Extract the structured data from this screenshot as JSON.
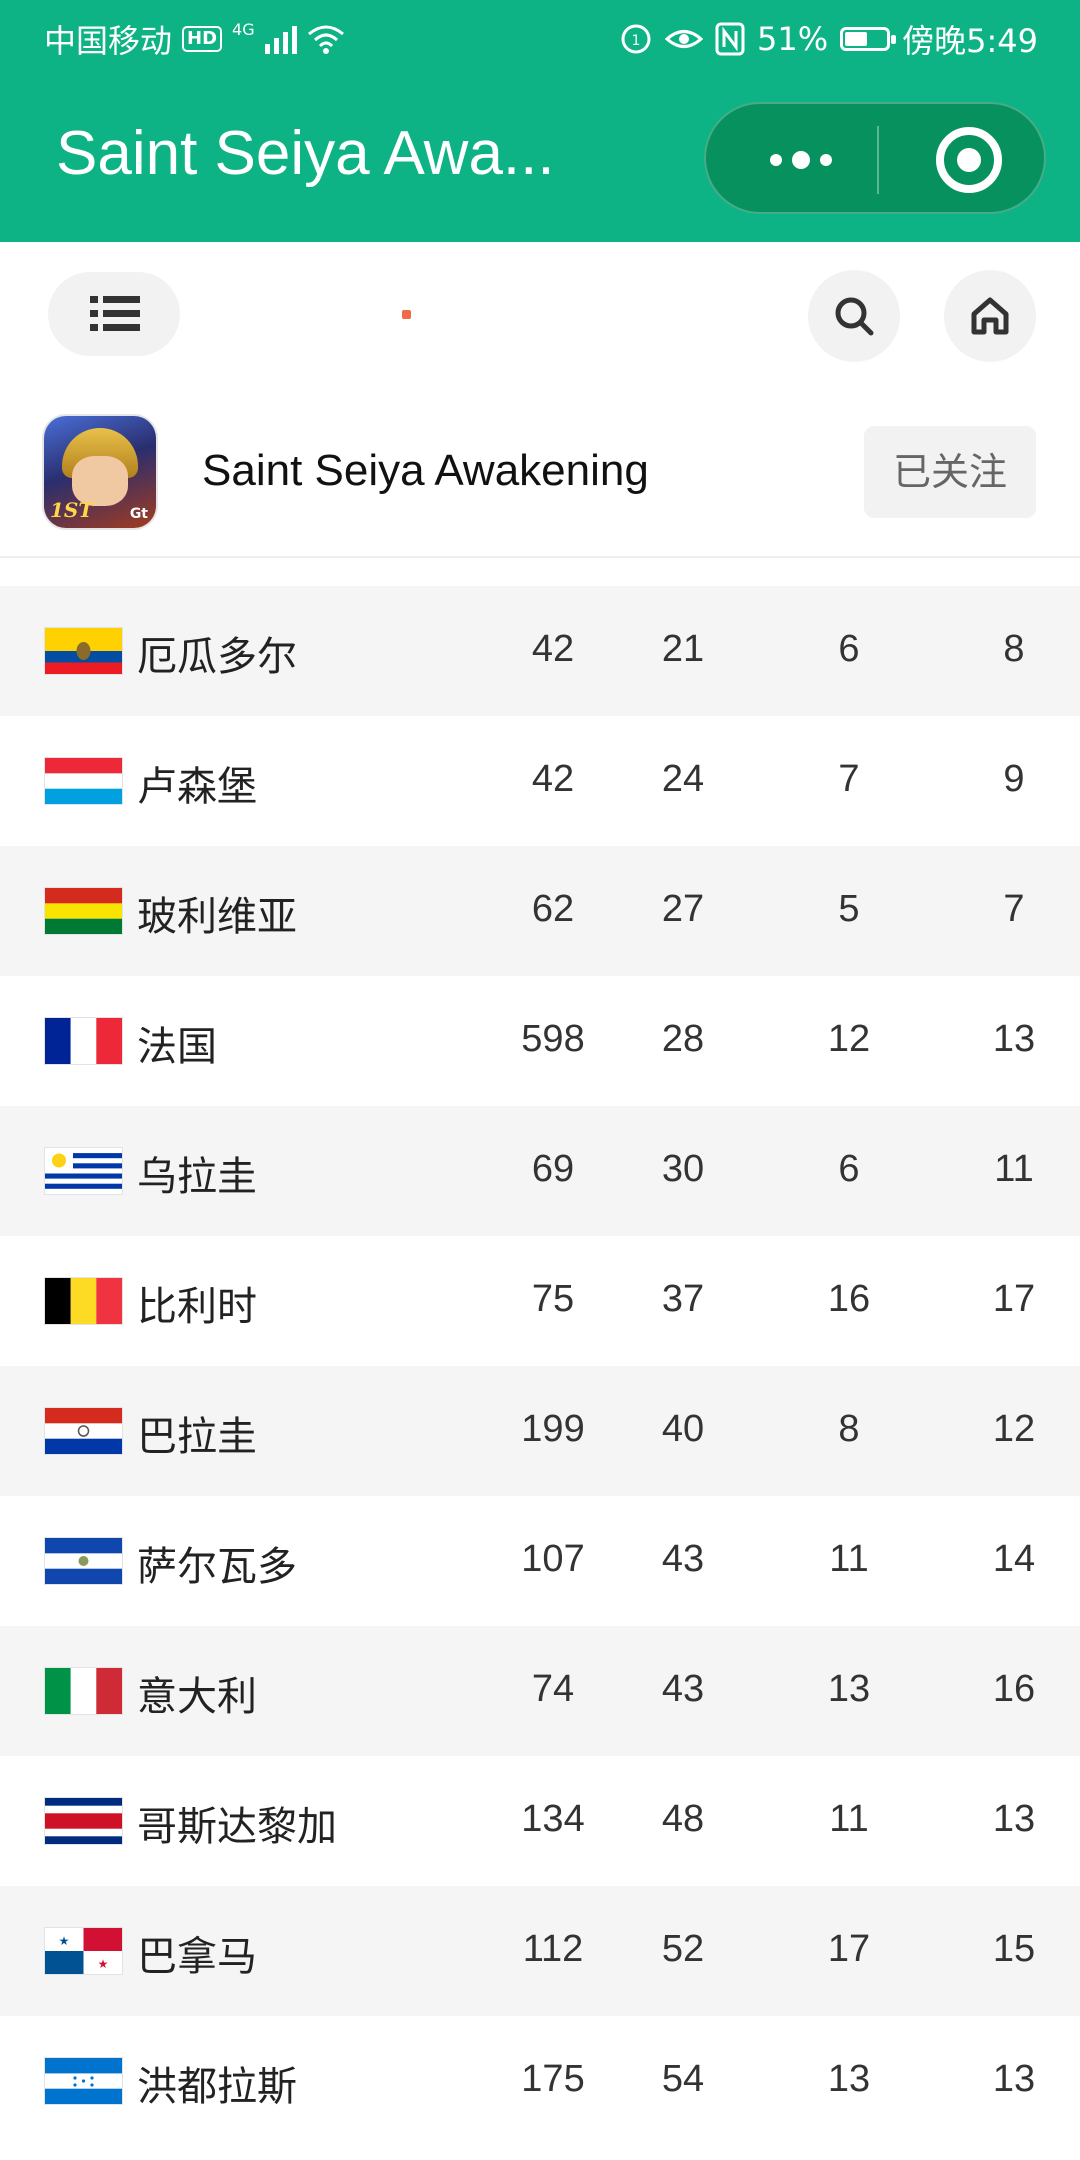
{
  "status_bar": {
    "carrier": "中国移动",
    "hd": "HD",
    "network": "4G",
    "battery_pct": "51%",
    "time": "傍晚5:49"
  },
  "header": {
    "title": "Saint Seiya Awa...",
    "more_icon": "more-dots-icon",
    "close_icon": "target-icon"
  },
  "toolbar": {
    "menu_icon": "list-icon",
    "search_icon": "search-icon",
    "home_icon": "home-icon"
  },
  "game": {
    "name": "Saint Seiya Awakening",
    "follow_label": "已关注",
    "icon_badge_text": "1ST",
    "icon_brand": "Gt"
  },
  "rows": [
    {
      "country": "厄瓜多尔",
      "flag": "ecuador",
      "v1": "42",
      "v2": "21",
      "v3": "6",
      "v4": "8"
    },
    {
      "country": "卢森堡",
      "flag": "luxembourg",
      "v1": "42",
      "v2": "24",
      "v3": "7",
      "v4": "9"
    },
    {
      "country": "玻利维亚",
      "flag": "bolivia",
      "v1": "62",
      "v2": "27",
      "v3": "5",
      "v4": "7"
    },
    {
      "country": "法国",
      "flag": "france",
      "v1": "598",
      "v2": "28",
      "v3": "12",
      "v4": "13"
    },
    {
      "country": "乌拉圭",
      "flag": "uruguay",
      "v1": "69",
      "v2": "30",
      "v3": "6",
      "v4": "11"
    },
    {
      "country": "比利时",
      "flag": "belgium",
      "v1": "75",
      "v2": "37",
      "v3": "16",
      "v4": "17"
    },
    {
      "country": "巴拉圭",
      "flag": "paraguay",
      "v1": "199",
      "v2": "40",
      "v3": "8",
      "v4": "12"
    },
    {
      "country": "萨尔瓦多",
      "flag": "el-salvador",
      "v1": "107",
      "v2": "43",
      "v3": "11",
      "v4": "14"
    },
    {
      "country": "意大利",
      "flag": "italy",
      "v1": "74",
      "v2": "43",
      "v3": "13",
      "v4": "16"
    },
    {
      "country": "哥斯达黎加",
      "flag": "costa-rica",
      "v1": "134",
      "v2": "48",
      "v3": "11",
      "v4": "13"
    },
    {
      "country": "巴拿马",
      "flag": "panama",
      "v1": "112",
      "v2": "52",
      "v3": "17",
      "v4": "15"
    },
    {
      "country": "洪都拉斯",
      "flag": "honduras",
      "v1": "175",
      "v2": "54",
      "v3": "13",
      "v4": "13"
    }
  ],
  "colors": {
    "header_green": "#0db384",
    "capsule_green": "#07915f",
    "row_alt": "#f5f5f5"
  }
}
